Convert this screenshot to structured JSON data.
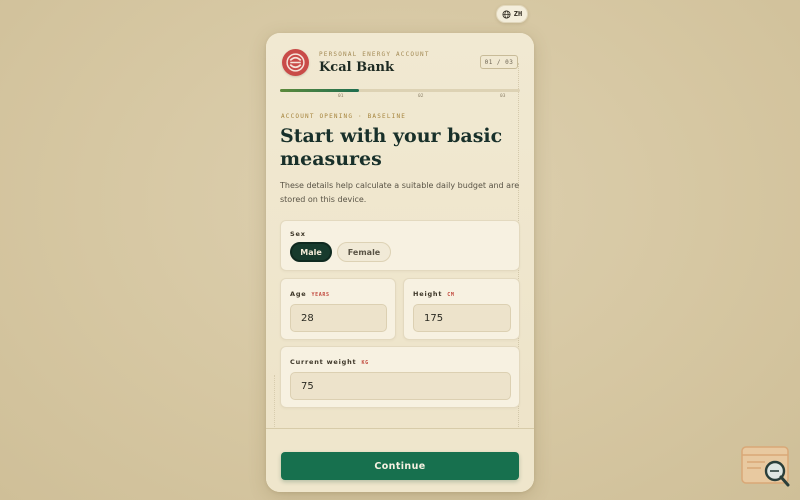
{
  "lang_toggle": {
    "label": "ZH",
    "icon": "globe-icon"
  },
  "brand": {
    "subtitle": "PERSONAL ENERGY ACCOUNT",
    "name": "Kcal Bank",
    "logo_icon": "bank-logo-icon",
    "logo_color": "#c94b48"
  },
  "step": {
    "indicator": "01 / 03",
    "progress": 0.33,
    "labels": [
      "01",
      "02",
      "03"
    ]
  },
  "eyebrow": "ACCOUNT OPENING · BASELINE",
  "headline": "Start with your basic measures",
  "description": "These details help calculate a suitable daily budget and are stored on this device.",
  "form": {
    "sex": {
      "label": "Sex",
      "options": [
        "Male",
        "Female"
      ],
      "selected": "Male"
    },
    "age": {
      "label": "Age",
      "unit": "YEARS",
      "value": "28"
    },
    "height": {
      "label": "Height",
      "unit": "CM",
      "value": "175"
    },
    "weight": {
      "label": "Current weight",
      "unit": "KG",
      "value": "75"
    }
  },
  "continue_label": "Continue",
  "colors": {
    "accent": "#17704e",
    "selected": "#173b2d",
    "unit": "#c24a3f",
    "eyebrow": "#a5843c"
  }
}
